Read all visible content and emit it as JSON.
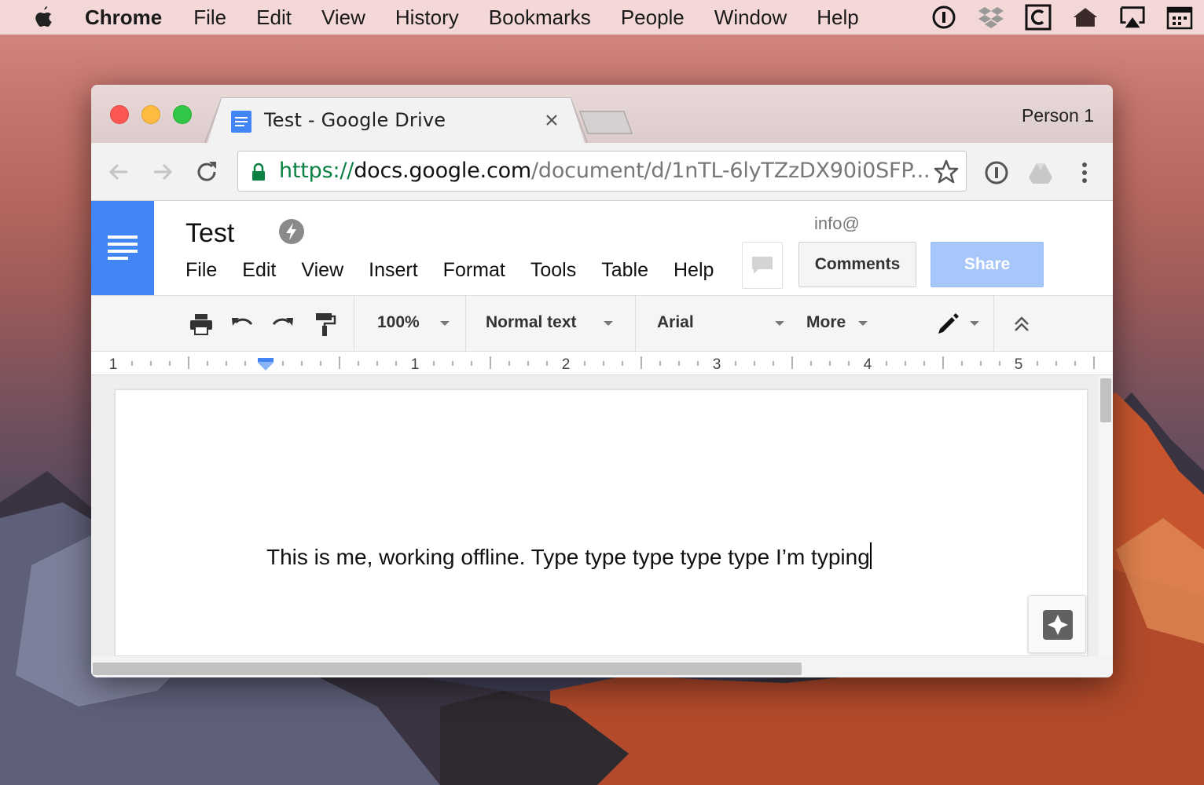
{
  "menubar": {
    "app": "Chrome",
    "items": [
      "File",
      "Edit",
      "View",
      "History",
      "Bookmarks",
      "People",
      "Window",
      "Help"
    ],
    "status_icons": [
      "1password-icon",
      "dropbox-icon",
      "clipboard-c-icon",
      "home-icon",
      "airplay-icon",
      "calendar-icon"
    ]
  },
  "browser": {
    "tab_title": "Test - Google Drive",
    "profile": "Person 1",
    "url": {
      "scheme": "https://",
      "host": "docs.google.com",
      "path": "/document/d/1nTL-6lyTZzDX90i0SFP..."
    }
  },
  "docs": {
    "title": "Test",
    "menu": [
      "File",
      "Edit",
      "View",
      "Insert",
      "Format",
      "Tools",
      "Table",
      "Help"
    ],
    "account": "info@",
    "comments_label": "Comments",
    "share_label": "Share",
    "toolbar": {
      "zoom": "100%",
      "style": "Normal text",
      "font": "Arial",
      "more": "More"
    },
    "ruler_labels": [
      "1",
      "1",
      "2",
      "3",
      "4",
      "5"
    ],
    "body_text": "This is me, working offline. Type type type type type I’m typing"
  },
  "colors": {
    "docs_blue": "#4285f4",
    "share_disabled": "#a7c7fa",
    "secure_green": "#0b8043"
  }
}
